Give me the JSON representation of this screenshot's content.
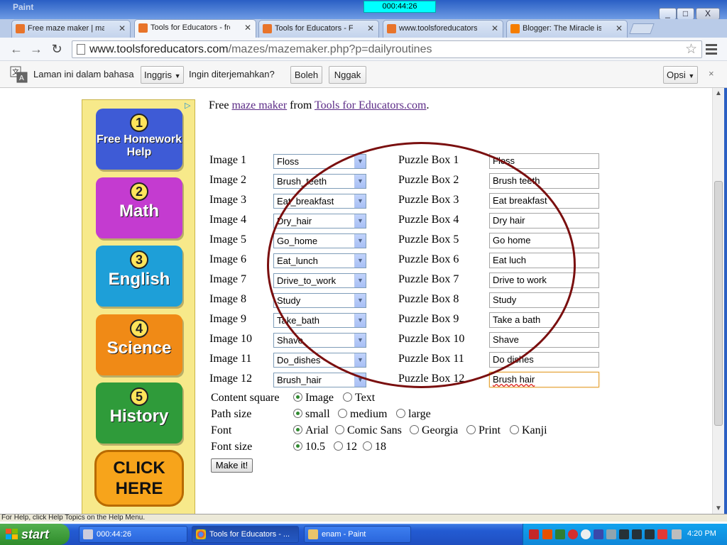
{
  "window": {
    "ghost_title": "Paint",
    "timer": "000:44:26",
    "buttons": [
      "_",
      "□",
      "X"
    ]
  },
  "tabs": [
    {
      "label": "Free maze maker | mazes",
      "icon": "tfe-favicon"
    },
    {
      "label": "Tools for Educators - free",
      "icon": "tfe-favicon",
      "active": true
    },
    {
      "label": "Tools for Educators - Free",
      "icon": "tfe-favicon"
    },
    {
      "label": "www.toolsforeducators.c",
      "icon": "tfe-favicon"
    },
    {
      "label": "Blogger: The Miracle is Yo",
      "icon": "blogger-favicon"
    }
  ],
  "toolbar": {
    "back": "←",
    "forward": "→",
    "reload": "↻",
    "url_host": "www.toolsforeducators.com",
    "url_path": "/mazes/mazemaker.php?p=dailyroutines"
  },
  "translate_bar": {
    "prefix": "Laman ini dalam bahasa",
    "language": "Inggris",
    "question": "Ingin diterjemahkan?",
    "yes": "Boleh",
    "no": "Nggak",
    "options": "Opsi",
    "close": "×"
  },
  "ad": {
    "choices": "▷",
    "tiles": [
      {
        "num": "1",
        "label": "Free Homework Help",
        "color": "#3e5bd6"
      },
      {
        "num": "2",
        "label": "Math",
        "color": "#c43bd0"
      },
      {
        "num": "3",
        "label": "English",
        "color": "#1e9fd8"
      },
      {
        "num": "4",
        "label": "Science",
        "color": "#f08a16"
      },
      {
        "num": "5",
        "label": "History",
        "color": "#2f9b3a"
      }
    ],
    "cta_line1": "CLICK",
    "cta_line2": "HERE"
  },
  "intro": {
    "prefix": "Free ",
    "link1": "maze maker",
    "middle": " from ",
    "link2": "Tools for Educators.com",
    "suffix": "."
  },
  "rows": [
    {
      "image_label": "Image 1",
      "image": "Floss",
      "box_label": "Puzzle Box 1",
      "box": "Floss"
    },
    {
      "image_label": "Image 2",
      "image": "Brush_teeth",
      "box_label": "Puzzle Box 2",
      "box": "Brush teeth"
    },
    {
      "image_label": "Image 3",
      "image": "Eat_breakfast",
      "box_label": "Puzzle Box 3",
      "box": "Eat breakfast"
    },
    {
      "image_label": "Image 4",
      "image": "Dry_hair",
      "box_label": "Puzzle Box 4",
      "box": "Dry hair"
    },
    {
      "image_label": "Image 5",
      "image": "Go_home",
      "box_label": "Puzzle Box 5",
      "box": "Go home"
    },
    {
      "image_label": "Image 6",
      "image": "Eat_lunch",
      "box_label": "Puzzle Box 6",
      "box": "Eat luch"
    },
    {
      "image_label": "Image 7",
      "image": "Drive_to_work",
      "box_label": "Puzzle Box 7",
      "box": "Drive to work"
    },
    {
      "image_label": "Image 8",
      "image": "Study",
      "box_label": "Puzzle Box 8",
      "box": "Study"
    },
    {
      "image_label": "Image 9",
      "image": "Take_bath",
      "box_label": "Puzzle Box 9",
      "box": "Take a bath"
    },
    {
      "image_label": "Image 10",
      "image": "Shave",
      "box_label": "Puzzle Box 10",
      "box": "Shave"
    },
    {
      "image_label": "Image 11",
      "image": "Do_dishes",
      "box_label": "Puzzle Box 11",
      "box": "Do dishes"
    },
    {
      "image_label": "Image 12",
      "image": "Brush_hair",
      "box_label": "Puzzle Box 12",
      "box": "Brush hair"
    }
  ],
  "options": {
    "content_square": {
      "label": "Content square",
      "choices": [
        "Image",
        "Text"
      ],
      "selected": "Image"
    },
    "path_size": {
      "label": "Path size",
      "choices": [
        "small",
        "medium",
        "large"
      ],
      "selected": "small"
    },
    "font": {
      "label": "Font",
      "choices": [
        "Arial",
        "Comic Sans",
        "Georgia",
        "Print",
        "Kanji"
      ],
      "selected": "Arial"
    },
    "font_size": {
      "label": "Font size",
      "choices": [
        "10.5",
        "12",
        "18"
      ],
      "selected": "10.5"
    }
  },
  "make_it": "Make it!",
  "status_text": "For Help, click Help Topics on the Help Menu.",
  "taskbar": {
    "start": "start",
    "tasks": [
      {
        "label": "000:44:26"
      },
      {
        "label": "Tools for Educators - ...",
        "active": true
      },
      {
        "label": "enam - Paint"
      }
    ],
    "clock": "4:20 PM"
  },
  "colors": {
    "annotation_circle": "#7a0f0f",
    "link": "#5b2a86",
    "radio_selected": "#2f8a2f"
  }
}
